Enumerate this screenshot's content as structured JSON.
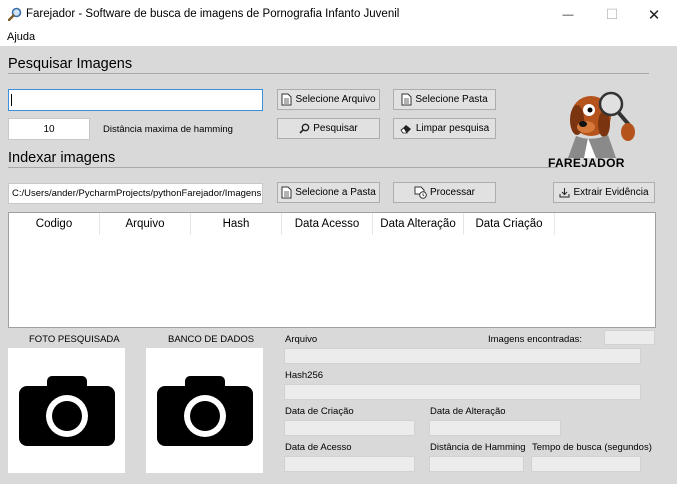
{
  "window": {
    "title": "Farejador - Software de busca de imagens de Pornografia Infanto Juvenil",
    "minimize_glyph": "—",
    "maximize_glyph": "☐",
    "close_glyph": "✕"
  },
  "menu": {
    "items": [
      "Ajuda"
    ]
  },
  "search_section": {
    "title": "Pesquisar Imagens",
    "image_path_value": "",
    "hamming_value": "10",
    "hamming_label": "Distância maxima de hamming",
    "select_file_button": "Selecione Arquivo",
    "select_folder_button": "Selecione Pasta",
    "search_button": "Pesquisar",
    "clear_button": "Limpar pesquisa"
  },
  "logo": {
    "text": "FAREJADOR"
  },
  "index_section": {
    "title": "Indexar imagens",
    "folder_path_value": "C:/Users/ander/PycharmProjects/pythonFarejador/Imagens",
    "select_folder_button": "Selecione a Pasta",
    "process_button": "Processar",
    "extract_button": "Extrair Evidência"
  },
  "results_table": {
    "columns": [
      "Codigo",
      "Arquivo",
      "Hash",
      "Data Acesso",
      "Data Alteração",
      "Data Criação"
    ],
    "rows": []
  },
  "photos": {
    "searched_label": "FOTO PESQUISADA",
    "database_label": "BANCO DE DADOS",
    "searched_icon": "camera-icon",
    "database_icon": "camera-icon"
  },
  "details": {
    "arquivo_label": "Arquivo",
    "arquivo_value": "",
    "found_label": "Imagens encontradas:",
    "found_value": "",
    "hash_label": "Hash256",
    "hash_value": "",
    "created_label": "Data de Criação",
    "created_value": "",
    "modified_label": "Data de Alteração",
    "modified_value": "",
    "accessed_label": "Data de Acesso",
    "accessed_value": "",
    "hamming_label": "Distância de Hamming",
    "hamming_value": "",
    "search_time_label": "Tempo de busca (segundos)",
    "search_time_value": ""
  }
}
